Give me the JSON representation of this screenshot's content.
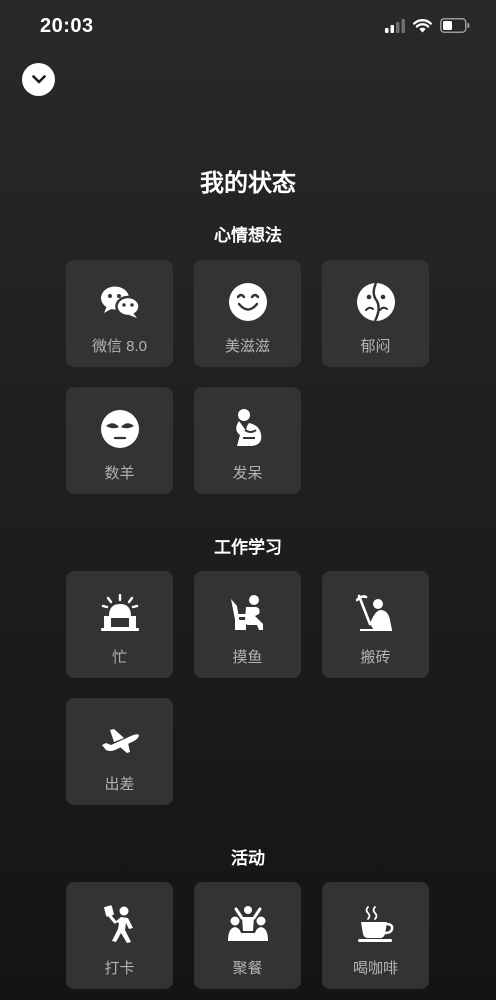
{
  "status_bar": {
    "time": "20:03"
  },
  "page_title": "我的状态",
  "sections": [
    {
      "title": "心情想法",
      "items": [
        {
          "label": "微信 8.0",
          "icon": "wechat-icon"
        },
        {
          "label": "美滋滋",
          "icon": "smile-icon"
        },
        {
          "label": "郁闷",
          "icon": "gloomy-icon"
        },
        {
          "label": "数羊",
          "icon": "sleepy-face-icon"
        },
        {
          "label": "发呆",
          "icon": "daze-icon"
        }
      ]
    },
    {
      "title": "工作学习",
      "items": [
        {
          "label": "忙",
          "icon": "alarm-laptop-icon"
        },
        {
          "label": "摸鱼",
          "icon": "slacking-icon"
        },
        {
          "label": "搬砖",
          "icon": "pickaxe-worker-icon"
        },
        {
          "label": "出差",
          "icon": "airplane-icon"
        }
      ]
    },
    {
      "title": "活动",
      "items": [
        {
          "label": "打卡",
          "icon": "check-in-icon"
        },
        {
          "label": "聚餐",
          "icon": "gathering-icon"
        },
        {
          "label": "喝咖啡",
          "icon": "coffee-icon"
        }
      ]
    }
  ]
}
